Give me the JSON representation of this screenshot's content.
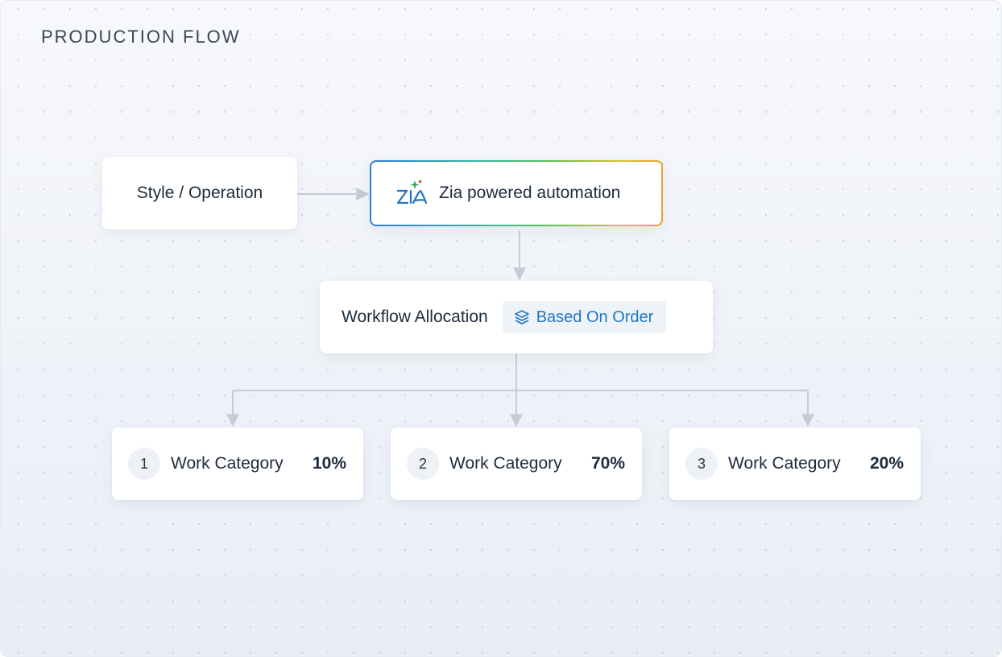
{
  "title": "PRODUCTION FLOW",
  "nodes": {
    "style_operation": "Style / Operation",
    "zia": "Zia powered automation",
    "workflow": "Workflow Allocation",
    "badge": "Based On Order"
  },
  "categories": [
    {
      "index": "1",
      "label": "Work Category",
      "percent": "10%"
    },
    {
      "index": "2",
      "label": "Work Category",
      "percent": "70%"
    },
    {
      "index": "3",
      "label": "Work Category",
      "percent": "20%"
    }
  ],
  "colors": {
    "connector": "#c3ccd8",
    "badge_text": "#2276c2",
    "zia_logo_blue": "#2276c2",
    "spark_green": "#2fa84f",
    "spark_red": "#e0473c"
  },
  "icons": {
    "badge": "layers-icon",
    "zia": "zia-logo-icon"
  }
}
